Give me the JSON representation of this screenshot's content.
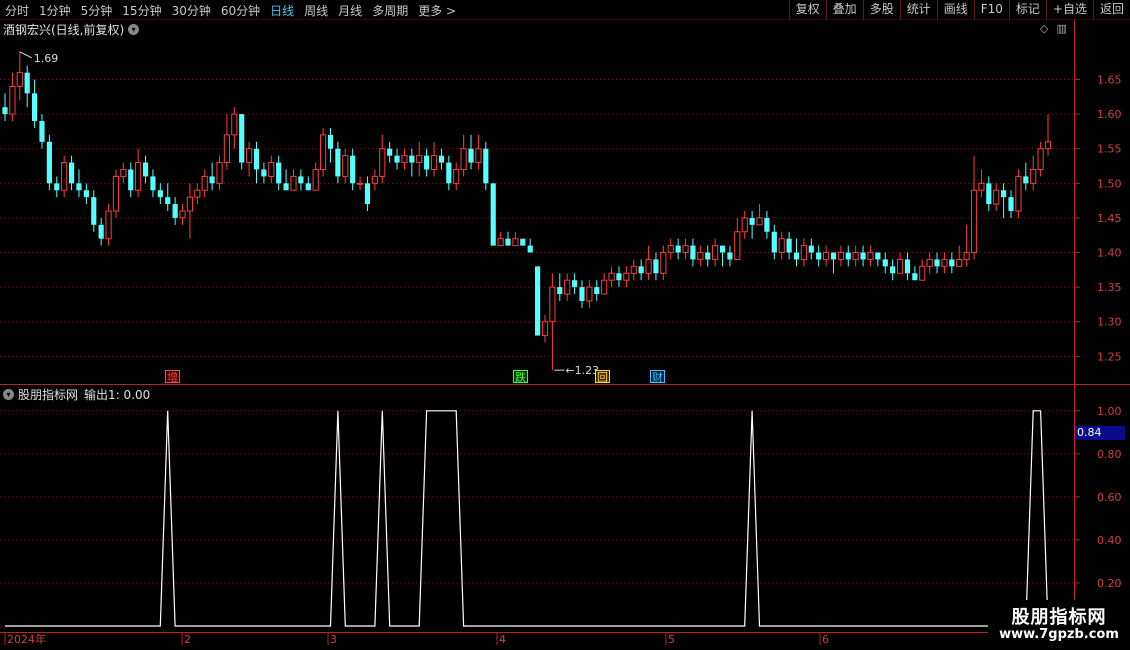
{
  "toolbar": {
    "periods": [
      "分时",
      "1分钟",
      "5分钟",
      "15分钟",
      "30分钟",
      "60分钟",
      "日线",
      "周线",
      "月线",
      "多周期",
      "更多 >"
    ],
    "active_index": 6,
    "tools": [
      "复权",
      "叠加",
      "多股",
      "统计",
      "画线",
      "F10",
      "标记",
      "+自选",
      "返回"
    ]
  },
  "stock": {
    "title": "酒钢宏兴(日线,前复权)",
    "high_label": "1.69",
    "low_label": "1.23"
  },
  "price_axis": [
    "1.65",
    "1.60",
    "1.55",
    "1.50",
    "1.45",
    "1.40",
    "1.35",
    "1.30",
    "1.25"
  ],
  "indicator": {
    "title": "股朋指标网",
    "output": "输出1: 0.00",
    "axis": [
      "1.00",
      "0.80",
      "0.60",
      "0.40",
      "0.20"
    ],
    "highlight": "0.84"
  },
  "events": [
    {
      "label": "增",
      "color": "#ff4040",
      "bg": "#3a0000"
    },
    {
      "label": "跌",
      "color": "#40ff40",
      "bg": "#003a00"
    },
    {
      "label": "回",
      "color": "#ffd040",
      "bg": "#3a2a00"
    },
    {
      "label": "财",
      "color": "#40c0ff",
      "bg": "#00203a"
    }
  ],
  "dates": [
    "2024年",
    "2",
    "3",
    "4",
    "5",
    "6"
  ],
  "watermark": {
    "title": "股朋指标网",
    "url": "www.7gpzb.com"
  },
  "colors": {
    "up": "#ff3c3c",
    "down": "#54ffff",
    "grid": "#7a1010",
    "line": "#ffffff"
  },
  "chart_data": {
    "type": "candlestick",
    "candles": [
      [
        1.61,
        1.6,
        1.63,
        1.59
      ],
      [
        1.6,
        1.64,
        1.66,
        1.59
      ],
      [
        1.64,
        1.66,
        1.69,
        1.62
      ],
      [
        1.66,
        1.63,
        1.67,
        1.61
      ],
      [
        1.63,
        1.59,
        1.65,
        1.58
      ],
      [
        1.59,
        1.56,
        1.6,
        1.55
      ],
      [
        1.56,
        1.5,
        1.57,
        1.49
      ],
      [
        1.5,
        1.49,
        1.51,
        1.48
      ],
      [
        1.49,
        1.53,
        1.54,
        1.48
      ],
      [
        1.53,
        1.5,
        1.54,
        1.49
      ],
      [
        1.5,
        1.49,
        1.52,
        1.48
      ],
      [
        1.49,
        1.48,
        1.5,
        1.47
      ],
      [
        1.48,
        1.44,
        1.49,
        1.43
      ],
      [
        1.44,
        1.42,
        1.45,
        1.41
      ],
      [
        1.42,
        1.46,
        1.47,
        1.41
      ],
      [
        1.46,
        1.51,
        1.52,
        1.45
      ],
      [
        1.51,
        1.52,
        1.53,
        1.5
      ],
      [
        1.52,
        1.49,
        1.53,
        1.48
      ],
      [
        1.49,
        1.53,
        1.55,
        1.48
      ],
      [
        1.53,
        1.51,
        1.54,
        1.5
      ],
      [
        1.51,
        1.49,
        1.52,
        1.48
      ],
      [
        1.49,
        1.48,
        1.5,
        1.47
      ],
      [
        1.48,
        1.47,
        1.5,
        1.46
      ],
      [
        1.47,
        1.45,
        1.48,
        1.44
      ],
      [
        1.45,
        1.46,
        1.47,
        1.44
      ],
      [
        1.46,
        1.48,
        1.5,
        1.42
      ],
      [
        1.48,
        1.49,
        1.5,
        1.47
      ],
      [
        1.49,
        1.51,
        1.52,
        1.48
      ],
      [
        1.51,
        1.5,
        1.53,
        1.49
      ],
      [
        1.5,
        1.53,
        1.54,
        1.49
      ],
      [
        1.53,
        1.57,
        1.6,
        1.52
      ],
      [
        1.57,
        1.6,
        1.61,
        1.55
      ],
      [
        1.6,
        1.53,
        1.6,
        1.52
      ],
      [
        1.53,
        1.55,
        1.56,
        1.51
      ],
      [
        1.55,
        1.52,
        1.56,
        1.5
      ],
      [
        1.52,
        1.51,
        1.53,
        1.5
      ],
      [
        1.51,
        1.53,
        1.54,
        1.5
      ],
      [
        1.53,
        1.5,
        1.54,
        1.49
      ],
      [
        1.5,
        1.49,
        1.52,
        1.49
      ],
      [
        1.49,
        1.51,
        1.52,
        1.49
      ],
      [
        1.51,
        1.5,
        1.52,
        1.49
      ],
      [
        1.5,
        1.49,
        1.51,
        1.49
      ],
      [
        1.49,
        1.52,
        1.53,
        1.49
      ],
      [
        1.52,
        1.57,
        1.58,
        1.51
      ],
      [
        1.57,
        1.55,
        1.58,
        1.53
      ],
      [
        1.55,
        1.51,
        1.56,
        1.5
      ],
      [
        1.51,
        1.54,
        1.55,
        1.5
      ],
      [
        1.54,
        1.5,
        1.55,
        1.49
      ],
      [
        1.5,
        1.5,
        1.51,
        1.49
      ],
      [
        1.5,
        1.47,
        1.51,
        1.46
      ],
      [
        1.5,
        1.51,
        1.52,
        1.49
      ],
      [
        1.51,
        1.55,
        1.57,
        1.5
      ],
      [
        1.55,
        1.54,
        1.56,
        1.53
      ],
      [
        1.54,
        1.53,
        1.55,
        1.52
      ],
      [
        1.53,
        1.54,
        1.55,
        1.52
      ],
      [
        1.54,
        1.53,
        1.55,
        1.51
      ],
      [
        1.53,
        1.54,
        1.56,
        1.51
      ],
      [
        1.54,
        1.52,
        1.55,
        1.51
      ],
      [
        1.52,
        1.54,
        1.56,
        1.51
      ],
      [
        1.54,
        1.53,
        1.55,
        1.52
      ],
      [
        1.53,
        1.5,
        1.54,
        1.49
      ],
      [
        1.5,
        1.52,
        1.53,
        1.49
      ],
      [
        1.52,
        1.55,
        1.57,
        1.51
      ],
      [
        1.55,
        1.53,
        1.57,
        1.52
      ],
      [
        1.53,
        1.55,
        1.57,
        1.52
      ],
      [
        1.55,
        1.5,
        1.56,
        1.49
      ],
      [
        1.5,
        1.41,
        1.5,
        1.41
      ],
      [
        1.41,
        1.42,
        1.43,
        1.41
      ],
      [
        1.42,
        1.41,
        1.43,
        1.41
      ],
      [
        1.41,
        1.42,
        1.43,
        1.41
      ],
      [
        1.42,
        1.41,
        1.42,
        1.41
      ],
      [
        1.41,
        1.4,
        1.42,
        1.4
      ],
      [
        1.38,
        1.28,
        1.38,
        1.28
      ],
      [
        1.28,
        1.3,
        1.31,
        1.27
      ],
      [
        1.3,
        1.35,
        1.37,
        1.23
      ],
      [
        1.35,
        1.34,
        1.37,
        1.33
      ],
      [
        1.34,
        1.36,
        1.37,
        1.33
      ],
      [
        1.36,
        1.35,
        1.37,
        1.34
      ],
      [
        1.35,
        1.33,
        1.36,
        1.32
      ],
      [
        1.33,
        1.35,
        1.36,
        1.32
      ],
      [
        1.35,
        1.34,
        1.36,
        1.33
      ],
      [
        1.34,
        1.36,
        1.37,
        1.34
      ],
      [
        1.36,
        1.37,
        1.38,
        1.35
      ],
      [
        1.37,
        1.36,
        1.38,
        1.35
      ],
      [
        1.36,
        1.37,
        1.38,
        1.35
      ],
      [
        1.37,
        1.38,
        1.39,
        1.36
      ],
      [
        1.38,
        1.37,
        1.39,
        1.36
      ],
      [
        1.37,
        1.39,
        1.41,
        1.36
      ],
      [
        1.39,
        1.37,
        1.4,
        1.36
      ],
      [
        1.37,
        1.4,
        1.41,
        1.36
      ],
      [
        1.4,
        1.41,
        1.42,
        1.39
      ],
      [
        1.41,
        1.4,
        1.42,
        1.39
      ],
      [
        1.4,
        1.41,
        1.42,
        1.39
      ],
      [
        1.41,
        1.39,
        1.42,
        1.38
      ],
      [
        1.39,
        1.4,
        1.41,
        1.38
      ],
      [
        1.4,
        1.39,
        1.41,
        1.38
      ],
      [
        1.39,
        1.41,
        1.42,
        1.38
      ],
      [
        1.41,
        1.4,
        1.41,
        1.38
      ],
      [
        1.4,
        1.39,
        1.41,
        1.38
      ],
      [
        1.39,
        1.43,
        1.45,
        1.39
      ],
      [
        1.43,
        1.45,
        1.46,
        1.42
      ],
      [
        1.45,
        1.44,
        1.46,
        1.42
      ],
      [
        1.44,
        1.45,
        1.47,
        1.44
      ],
      [
        1.45,
        1.43,
        1.46,
        1.42
      ],
      [
        1.43,
        1.4,
        1.44,
        1.39
      ],
      [
        1.4,
        1.42,
        1.43,
        1.39
      ],
      [
        1.42,
        1.4,
        1.43,
        1.39
      ],
      [
        1.4,
        1.39,
        1.42,
        1.38
      ],
      [
        1.39,
        1.41,
        1.42,
        1.38
      ],
      [
        1.41,
        1.4,
        1.42,
        1.39
      ],
      [
        1.4,
        1.39,
        1.41,
        1.38
      ],
      [
        1.39,
        1.4,
        1.41,
        1.38
      ],
      [
        1.4,
        1.39,
        1.4,
        1.37
      ],
      [
        1.39,
        1.4,
        1.41,
        1.38
      ],
      [
        1.4,
        1.39,
        1.41,
        1.38
      ],
      [
        1.39,
        1.4,
        1.41,
        1.38
      ],
      [
        1.4,
        1.39,
        1.41,
        1.38
      ],
      [
        1.39,
        1.4,
        1.41,
        1.38
      ],
      [
        1.4,
        1.39,
        1.4,
        1.38
      ],
      [
        1.39,
        1.38,
        1.4,
        1.37
      ],
      [
        1.38,
        1.37,
        1.39,
        1.36
      ],
      [
        1.37,
        1.39,
        1.4,
        1.37
      ],
      [
        1.39,
        1.37,
        1.4,
        1.36
      ],
      [
        1.37,
        1.36,
        1.38,
        1.36
      ],
      [
        1.36,
        1.38,
        1.39,
        1.36
      ],
      [
        1.38,
        1.39,
        1.4,
        1.37
      ],
      [
        1.39,
        1.38,
        1.4,
        1.37
      ],
      [
        1.38,
        1.39,
        1.4,
        1.37
      ],
      [
        1.39,
        1.38,
        1.4,
        1.37
      ],
      [
        1.38,
        1.39,
        1.41,
        1.38
      ],
      [
        1.39,
        1.4,
        1.44,
        1.38
      ],
      [
        1.4,
        1.49,
        1.54,
        1.39
      ],
      [
        1.49,
        1.5,
        1.52,
        1.48
      ],
      [
        1.5,
        1.47,
        1.51,
        1.46
      ],
      [
        1.47,
        1.49,
        1.5,
        1.46
      ],
      [
        1.49,
        1.48,
        1.5,
        1.45
      ],
      [
        1.48,
        1.46,
        1.49,
        1.45
      ],
      [
        1.46,
        1.51,
        1.52,
        1.45
      ],
      [
        1.51,
        1.5,
        1.53,
        1.49
      ],
      [
        1.5,
        1.52,
        1.54,
        1.49
      ],
      [
        1.52,
        1.55,
        1.56,
        1.51
      ],
      [
        1.55,
        1.56,
        1.6,
        1.54
      ]
    ],
    "indicator_values": [
      0,
      0,
      0,
      0,
      0,
      0,
      0,
      0,
      0,
      0,
      0,
      0,
      0,
      0,
      0,
      0,
      0,
      0,
      0,
      0,
      0,
      0,
      1,
      0,
      0,
      0,
      0,
      0,
      0,
      0,
      0,
      0,
      0,
      0,
      0,
      0,
      0,
      0,
      0,
      0,
      0,
      0,
      0,
      0,
      0,
      1,
      0,
      0,
      0,
      0,
      0,
      1,
      0,
      0,
      0,
      0,
      0,
      1,
      1,
      1,
      1,
      1,
      0,
      0,
      0,
      0,
      0,
      0,
      0,
      0,
      0,
      0,
      0,
      0,
      0,
      0,
      0,
      0,
      0,
      0,
      0,
      0,
      0,
      0,
      0,
      0,
      0,
      0,
      0,
      0,
      0,
      0,
      0,
      0,
      0,
      0,
      0,
      0,
      0,
      0,
      0,
      1,
      0,
      0,
      0,
      0,
      0,
      0,
      0,
      0,
      0,
      0,
      0,
      0,
      0,
      0,
      0,
      0,
      0,
      0,
      0,
      0,
      0,
      0,
      0,
      0,
      0,
      0,
      0,
      0,
      0,
      0,
      0,
      0,
      0,
      0,
      0,
      0,
      0,
      1,
      1,
      0,
      0,
      0,
      0,
      0,
      0,
      0
    ],
    "ylim": [
      1.21,
      1.71
    ],
    "indicator_ylim": [
      0,
      1.05
    ]
  }
}
